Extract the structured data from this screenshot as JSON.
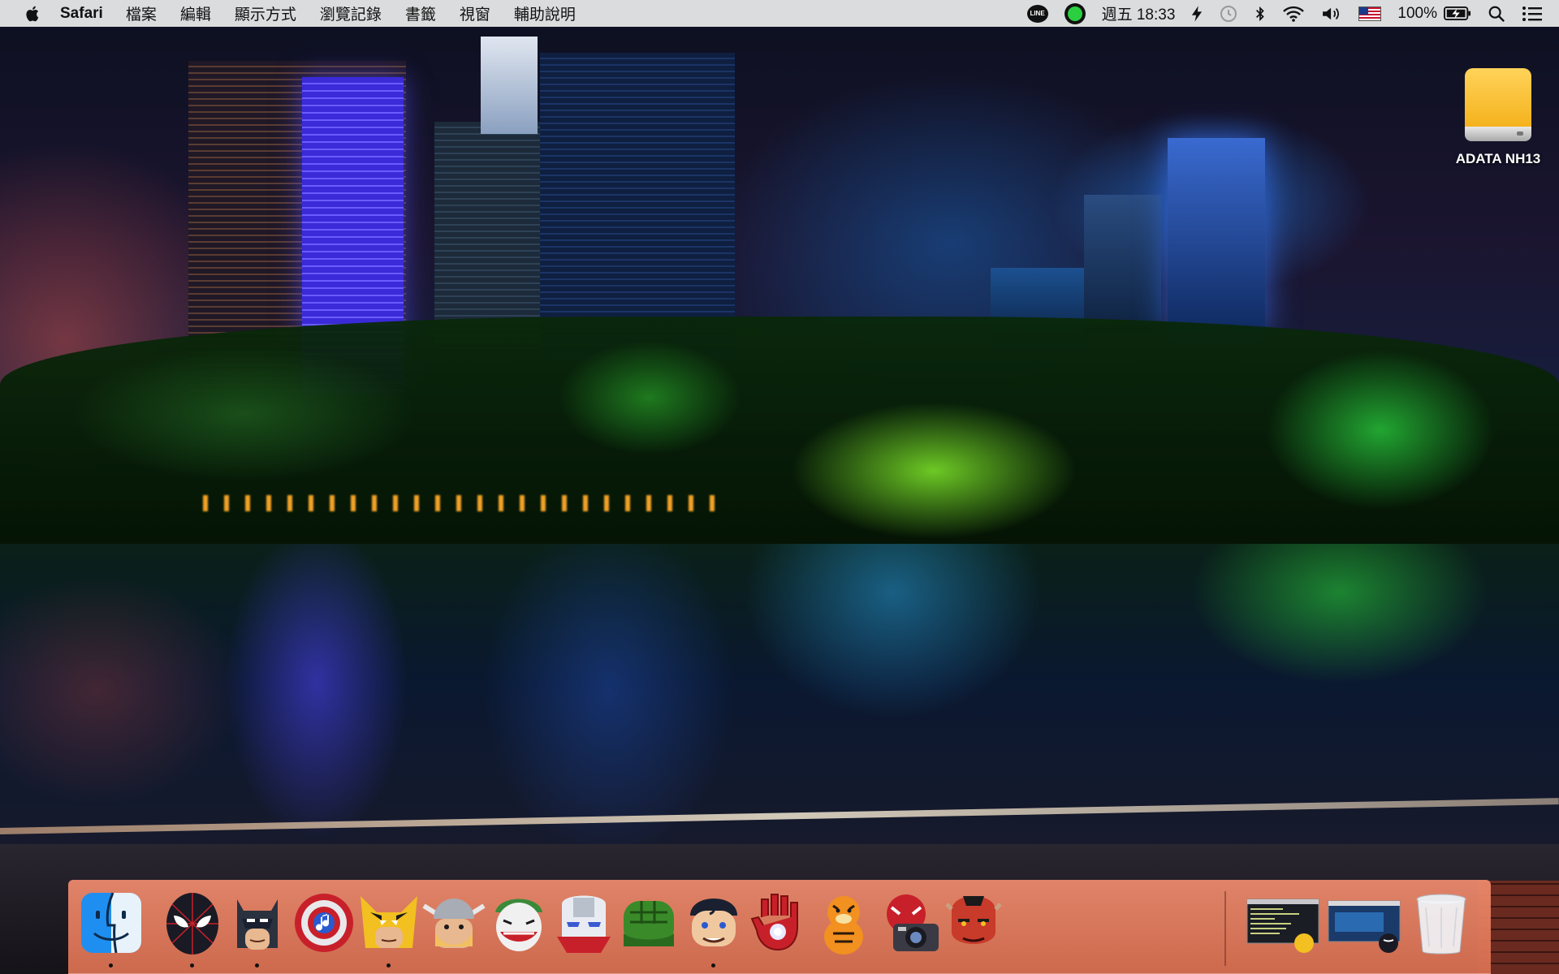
{
  "menubar": {
    "app_name": "Safari",
    "menus": [
      "檔案",
      "編輯",
      "顯示方式",
      "瀏覽記錄",
      "書籤",
      "視窗",
      "輔助說明"
    ],
    "line_label": "LINE",
    "clock": "週五 18:33",
    "battery_percent": "100%",
    "status_icons": [
      "line-icon",
      "green-circle-icon",
      "flash-icon",
      "time-machine-icon",
      "bluetooth-icon",
      "wifi-icon",
      "volume-icon",
      "us-flag-icon",
      "battery-charging-icon",
      "spotlight-icon",
      "notification-center-icon"
    ]
  },
  "desktop": {
    "drive_label": "ADATA NH13"
  },
  "dock": {
    "apps": [
      {
        "name": "finder",
        "icon": "finder-icon",
        "running": true
      },
      {
        "name": "spider-man",
        "icon": "spider-man-mask-icon",
        "running": true
      },
      {
        "name": "batman",
        "icon": "batman-icon",
        "running": true
      },
      {
        "name": "captain-america-shield",
        "icon": "shield-music-icon",
        "running": false
      },
      {
        "name": "wolverine",
        "icon": "wolverine-icon",
        "running": true
      },
      {
        "name": "thor",
        "icon": "thor-icon",
        "running": false
      },
      {
        "name": "joker",
        "icon": "joker-icon",
        "running": false
      },
      {
        "name": "iron-patriot",
        "icon": "iron-patriot-icon",
        "running": false
      },
      {
        "name": "hulk-fist",
        "icon": "hulk-fist-icon",
        "running": false
      },
      {
        "name": "superman",
        "icon": "superman-icon",
        "running": true
      },
      {
        "name": "iron-man-hand",
        "icon": "iron-man-hand-icon",
        "running": false
      },
      {
        "name": "tigger",
        "icon": "tigger-icon",
        "running": false
      },
      {
        "name": "camera-hero",
        "icon": "camera-icon",
        "running": false
      },
      {
        "name": "hellboy",
        "icon": "hellboy-icon",
        "running": false
      }
    ],
    "minimized": [
      {
        "name": "terminal-window",
        "icon": "terminal-thumbnail-icon"
      },
      {
        "name": "safari-window",
        "icon": "safari-thumbnail-icon"
      }
    ],
    "trash": {
      "icon": "trash-icon"
    }
  }
}
